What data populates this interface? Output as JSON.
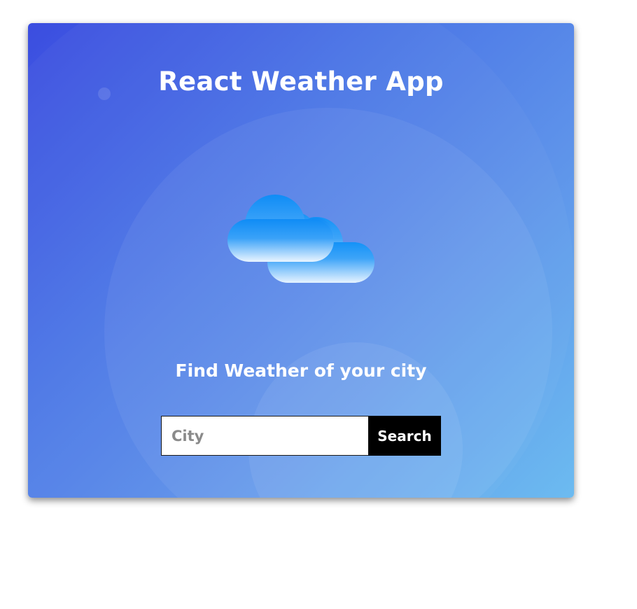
{
  "app": {
    "title": "React Weather App",
    "subtitle": "Find Weather of your city"
  },
  "search": {
    "placeholder": "City",
    "value": "",
    "button_label": "Search"
  },
  "illustration": {
    "icon": "cloudy-weather-icon"
  },
  "colors": {
    "gradient_start": "#3b4de0",
    "gradient_end": "#6cbbf0",
    "button_bg": "#000000",
    "text": "#ffffff",
    "cloud_top": "#1a8ff5",
    "cloud_bottom": "#e8f4ff"
  }
}
